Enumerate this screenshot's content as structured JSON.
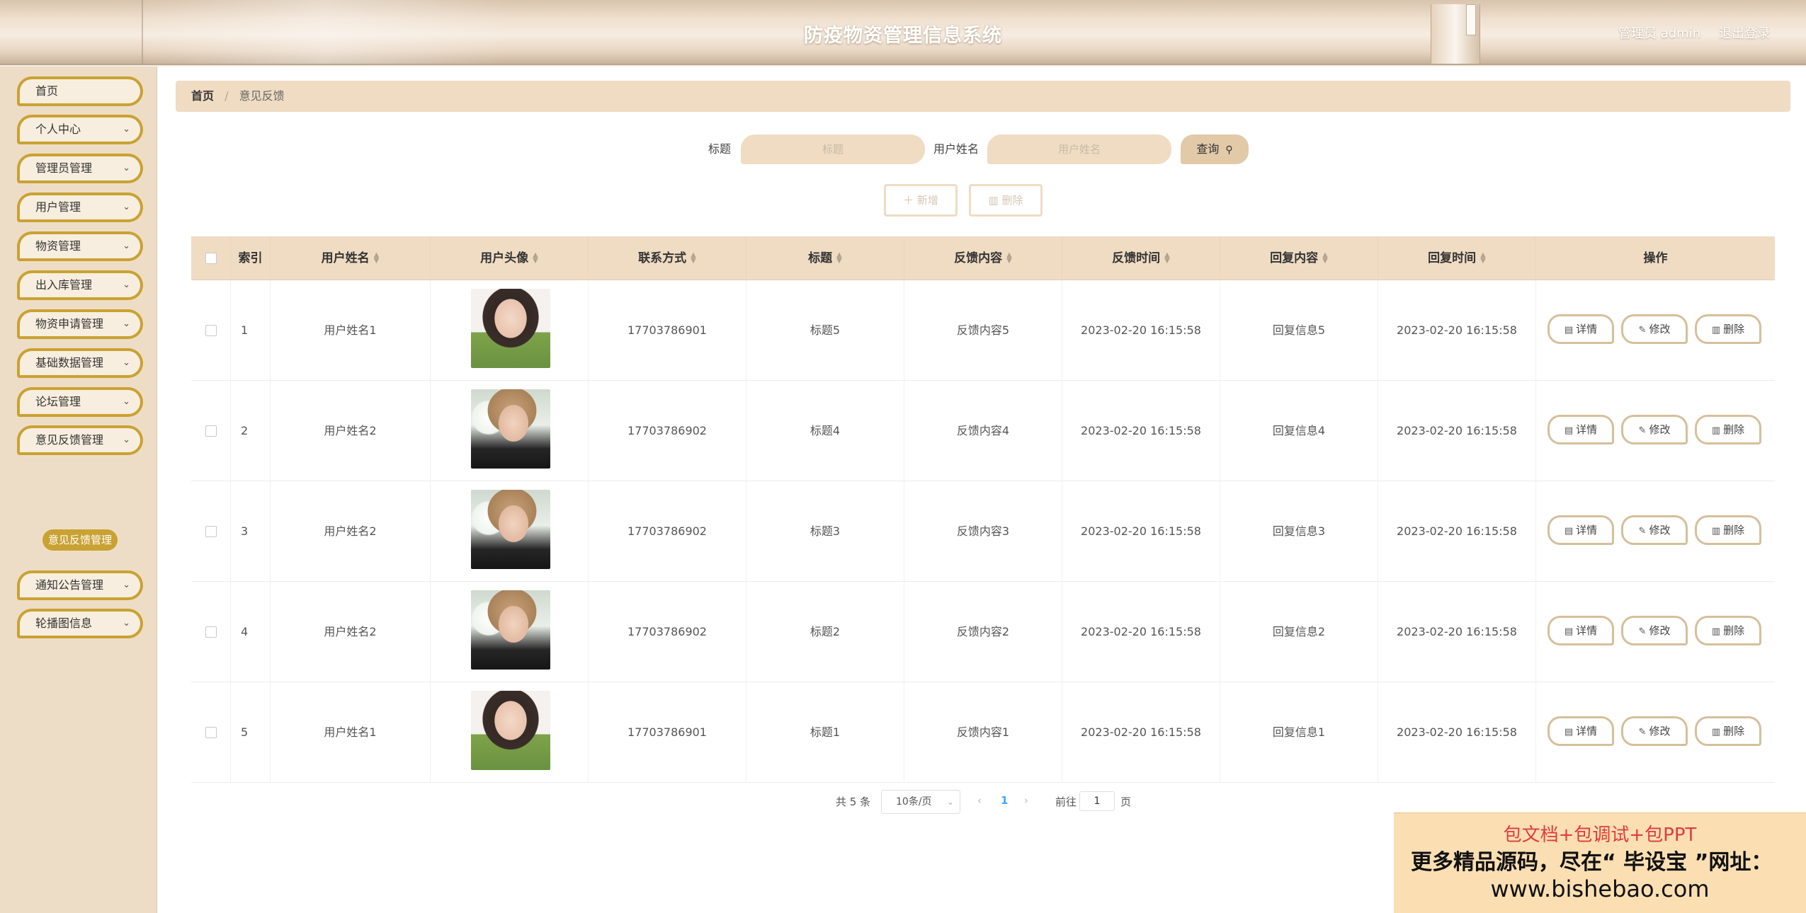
{
  "header": {
    "title": "防疫物资管理信息系统",
    "user": "管理员 admin",
    "logout": "退出登录"
  },
  "sidebar": {
    "items": [
      {
        "label": "首页",
        "has_children": false
      },
      {
        "label": "个人中心",
        "has_children": true
      },
      {
        "label": "管理员管理",
        "has_children": true
      },
      {
        "label": "用户管理",
        "has_children": true
      },
      {
        "label": "物资管理",
        "has_children": true
      },
      {
        "label": "出入库管理",
        "has_children": true
      },
      {
        "label": "物资申请管理",
        "has_children": true
      },
      {
        "label": "基础数据管理",
        "has_children": true
      },
      {
        "label": "论坛管理",
        "has_children": true
      },
      {
        "label": "意见反馈管理",
        "has_children": true
      },
      {
        "label": "通知公告管理",
        "has_children": true
      },
      {
        "label": "轮播图信息",
        "has_children": true
      }
    ],
    "active_sub": "意见反馈管理"
  },
  "breadcrumb": {
    "home": "首页",
    "separator": "/",
    "current": "意见反馈"
  },
  "search": {
    "title_label": "标题",
    "title_placeholder": "标题",
    "name_label": "用户姓名",
    "name_placeholder": "用户姓名",
    "query_button": "查询"
  },
  "actions": {
    "add": "新增",
    "delete": "删除"
  },
  "table": {
    "columns": [
      "索引",
      "用户姓名",
      "用户头像",
      "联系方式",
      "标题",
      "反馈内容",
      "反馈时间",
      "回复内容",
      "回复时间",
      "操作"
    ],
    "rows": [
      {
        "index": "1",
        "name": "用户姓名1",
        "avatar": "avatar-1",
        "phone": "17703786901",
        "title": "标题5",
        "content": "反馈内容5",
        "time": "2023-02-20 16:15:58",
        "reply": "回复信息5",
        "reply_time": "2023-02-20 16:15:58"
      },
      {
        "index": "2",
        "name": "用户姓名2",
        "avatar": "avatar-2",
        "phone": "17703786902",
        "title": "标题4",
        "content": "反馈内容4",
        "time": "2023-02-20 16:15:58",
        "reply": "回复信息4",
        "reply_time": "2023-02-20 16:15:58"
      },
      {
        "index": "3",
        "name": "用户姓名2",
        "avatar": "avatar-2",
        "phone": "17703786902",
        "title": "标题3",
        "content": "反馈内容3",
        "time": "2023-02-20 16:15:58",
        "reply": "回复信息3",
        "reply_time": "2023-02-20 16:15:58"
      },
      {
        "index": "4",
        "name": "用户姓名2",
        "avatar": "avatar-2",
        "phone": "17703786902",
        "title": "标题2",
        "content": "反馈内容2",
        "time": "2023-02-20 16:15:58",
        "reply": "回复信息2",
        "reply_time": "2023-02-20 16:15:58"
      },
      {
        "index": "5",
        "name": "用户姓名1",
        "avatar": "avatar-1",
        "phone": "17703786901",
        "title": "标题1",
        "content": "反馈内容1",
        "time": "2023-02-20 16:15:58",
        "reply": "回复信息1",
        "reply_time": "2023-02-20 16:15:58"
      }
    ],
    "row_actions": {
      "detail": "详情",
      "edit": "修改",
      "delete": "删除"
    }
  },
  "pagination": {
    "total": "共 5 条",
    "page_size": "10条/页",
    "current_page": "1",
    "goto_prefix": "前往",
    "goto_value": "1",
    "goto_suffix": "页"
  },
  "ad": {
    "line1": "包文档+包调试+包PPT",
    "line2": "更多精品源码，尽在“ 毕设宝 ”网址：",
    "line3": "www.bishebao.com"
  },
  "colors": {
    "accent": "#c9a233",
    "header_bg": "#efe0cf",
    "sidebar_bg": "#eeddc6",
    "table_head": "#efdcc3",
    "page_active": "#3fa8ff",
    "ad_red": "#e23b3b"
  }
}
